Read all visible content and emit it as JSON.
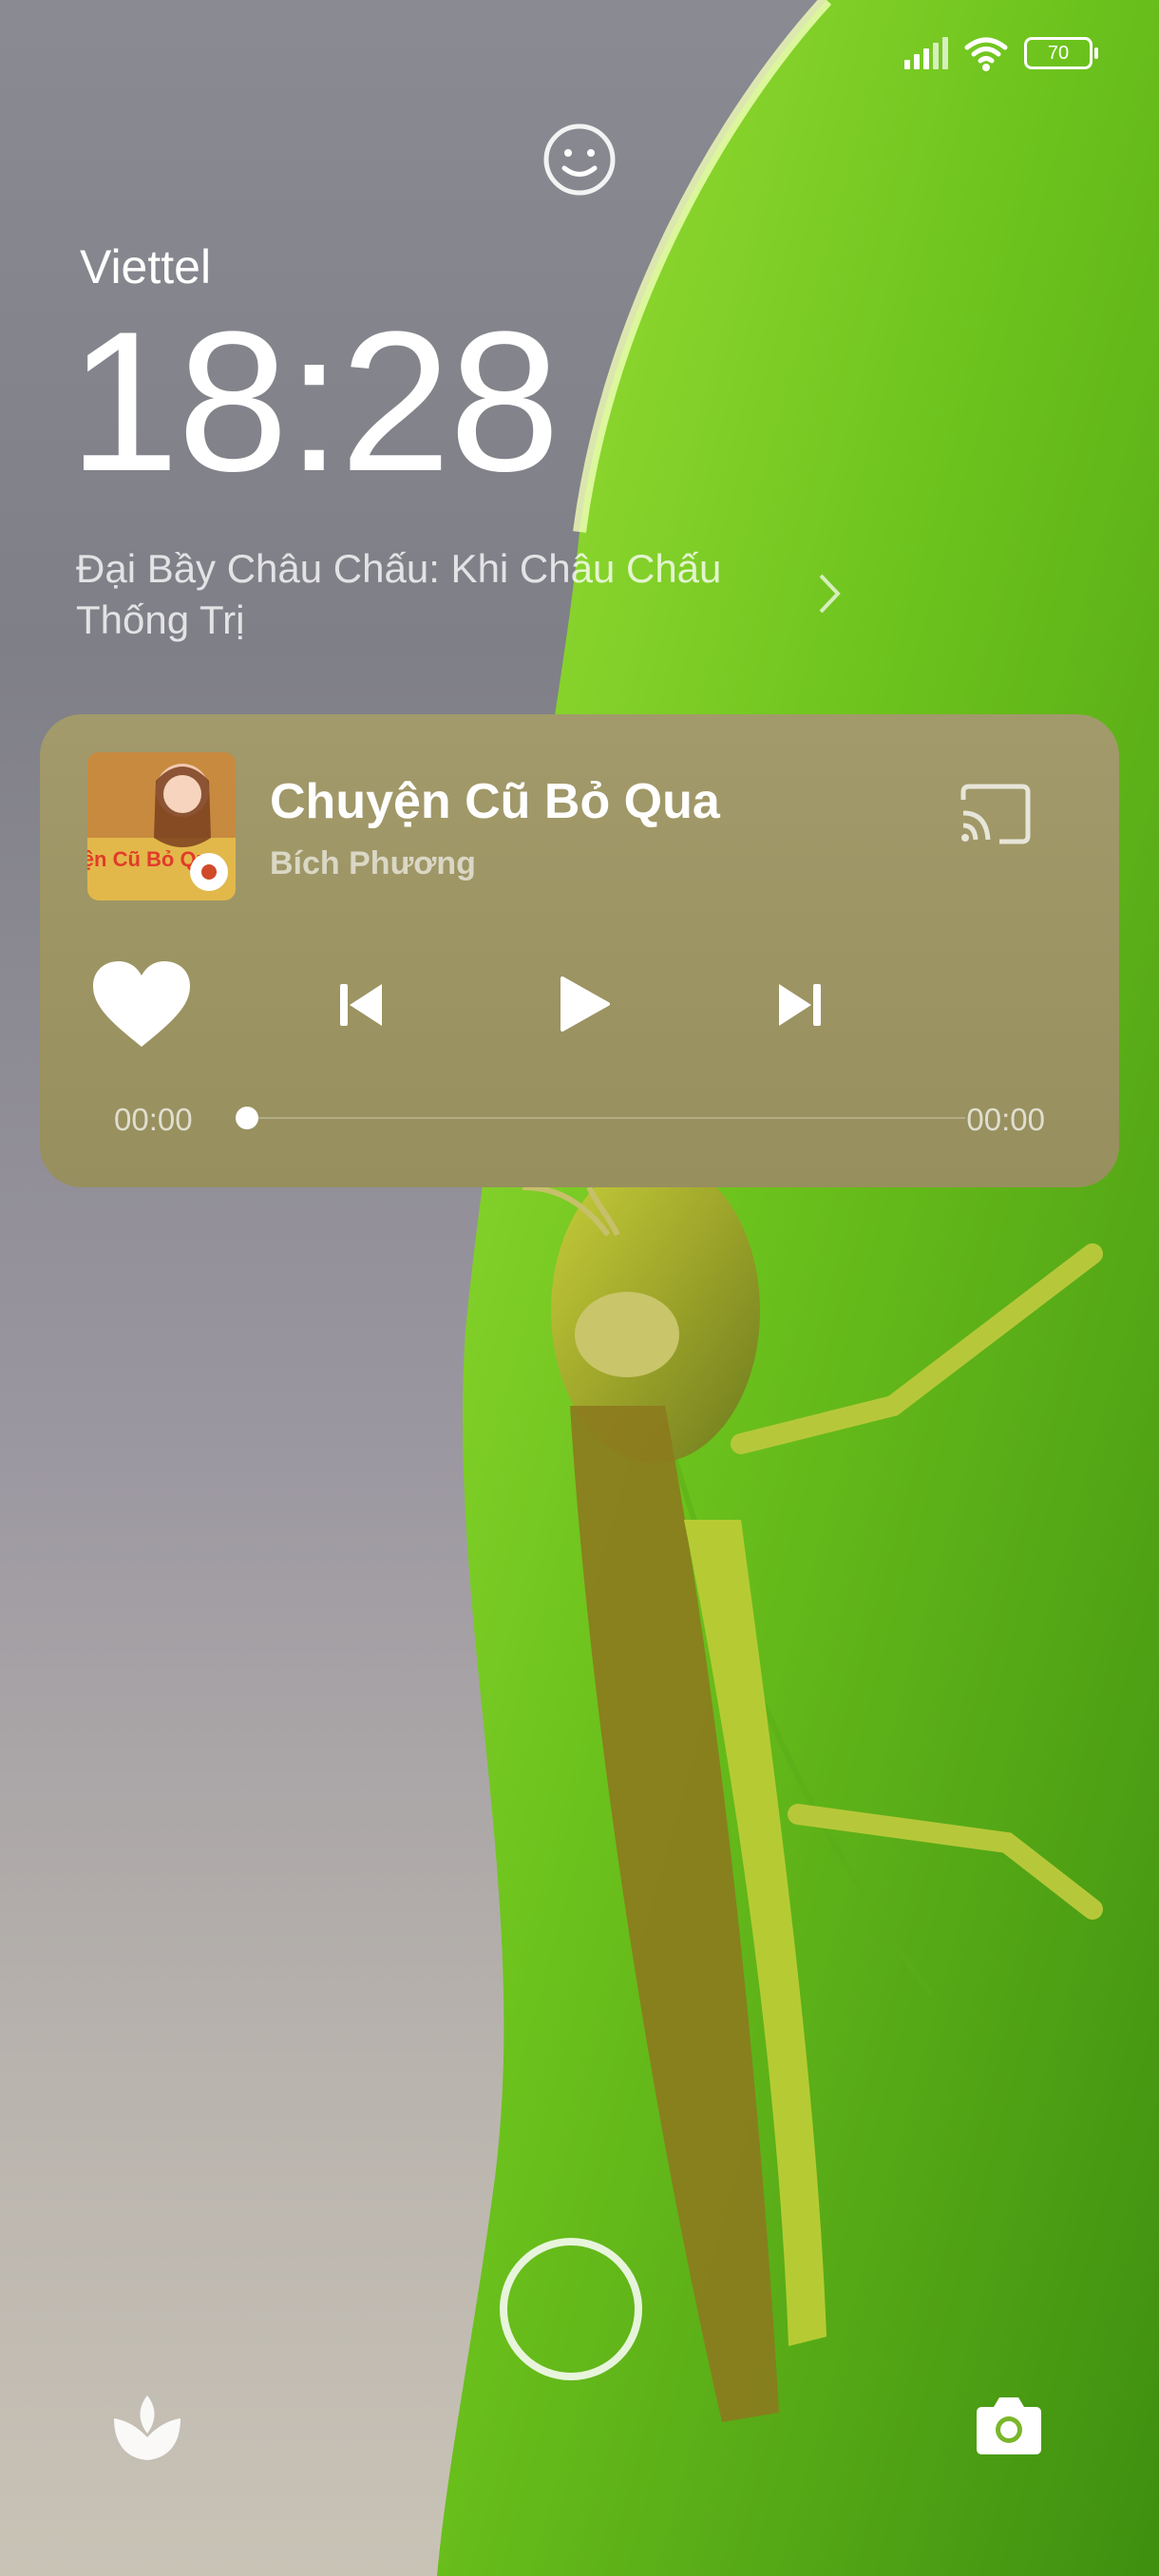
{
  "status_bar": {
    "battery": "70"
  },
  "lock_screen": {
    "carrier": "Viettel",
    "time": "18:28",
    "notification_text": "Đại Bầy Châu Chấu: Khi Châu Chấu Thống Trị"
  },
  "media_player": {
    "album_art_text": "Chuyện Cũ Bỏ Qua",
    "title": "Chuyện Cũ Bỏ Qua",
    "artist": "Bích Phương",
    "elapsed": "00:00",
    "duration": "00:00",
    "progress": 0,
    "card_color": "#9c9462"
  },
  "icons": [
    "signal-icon",
    "wifi-icon",
    "battery-icon",
    "face-icon",
    "chevron-right-icon",
    "cast-icon",
    "heart-icon",
    "previous-icon",
    "play-icon",
    "next-icon",
    "tulip-icon",
    "camera-icon"
  ],
  "colors": {
    "leaf_green": "#6cc21c",
    "text": "#ffffff"
  }
}
